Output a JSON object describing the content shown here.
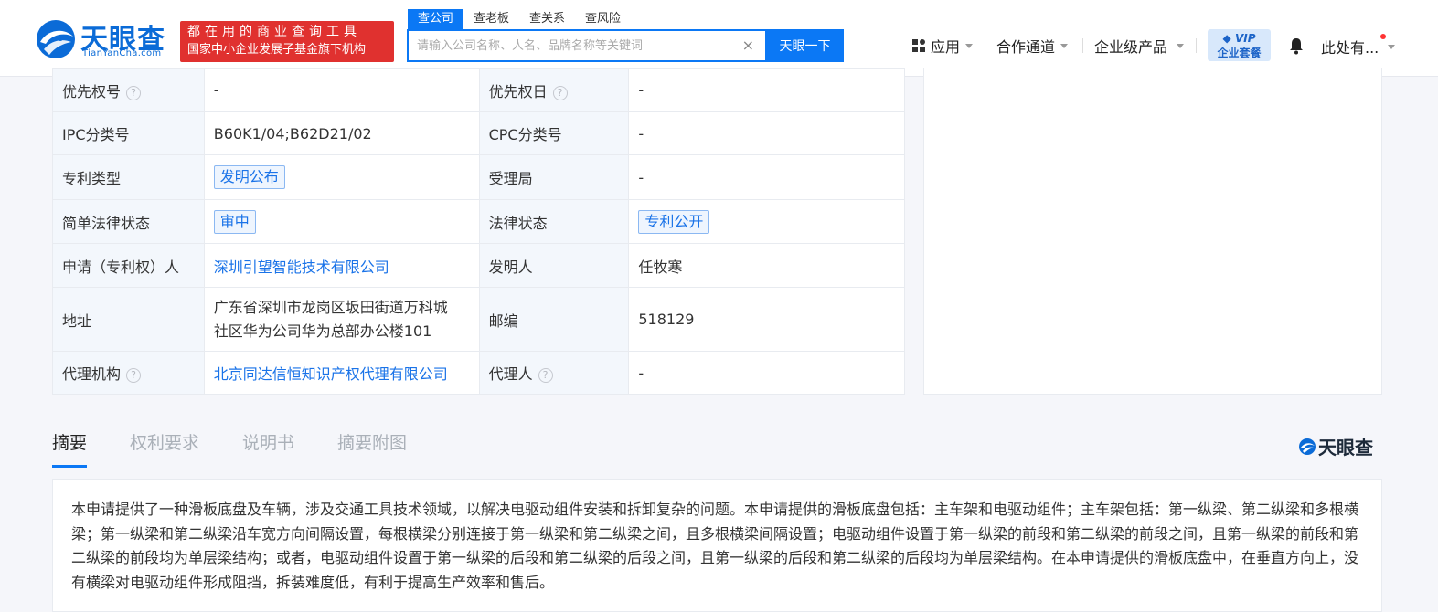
{
  "header": {
    "logo_text": "天眼查",
    "logo_sub": "TianYanCha.com",
    "slogan_line1": "都在用的商业查询工具",
    "slogan_line2": "国家中小企业发展子基金旗下机构",
    "search_tabs": [
      "查公司",
      "查老板",
      "查关系",
      "查风险"
    ],
    "search_placeholder": "请输入公司名称、人名、品牌名称等关键词",
    "search_button": "天眼一下",
    "nav": {
      "apps": "应用",
      "cooperation": "合作通道",
      "enterprise": "企业级产品",
      "vip_line1": "VIP",
      "vip_line2": "企业套餐",
      "user": "此处有..."
    }
  },
  "info_rows": [
    {
      "l1": "优先权号",
      "v1": "-",
      "l2": "优先权日",
      "v2": "-"
    },
    {
      "l1": "IPC分类号",
      "v1": "B60K1/04;B62D21/02",
      "l2": "CPC分类号",
      "v2": "-"
    },
    {
      "l1": "专利类型",
      "v1": "发明公布",
      "l2": "受理局",
      "v2": "-"
    },
    {
      "l1": "简单法律状态",
      "v1": "审中",
      "l2": "法律状态",
      "v2": "专利公开"
    },
    {
      "l1": "申请（专利权）人",
      "v1": "深圳引望智能技术有限公司",
      "l2": "发明人",
      "v2": "任牧寒"
    },
    {
      "l1": "地址",
      "v1a": "广东省深圳市龙岗区坂田街道万科城",
      "v1b": "社区华为公司华为总部办公楼101",
      "l2": "邮编",
      "v2": "518129"
    },
    {
      "l1": "代理机构",
      "v1": "北京同达信恒知识产权代理有限公司",
      "l2": "代理人",
      "v2": "-"
    }
  ],
  "content_tabs": [
    "摘要",
    "权利要求",
    "说明书",
    "摘要附图"
  ],
  "brand_small": "天眼查",
  "abstract": "本申请提供了一种滑板底盘及车辆，涉及交通工具技术领域，以解决电驱动组件安装和拆卸复杂的问题。本申请提供的滑板底盘包括：主车架和电驱动组件；主车架包括：第一纵梁、第二纵梁和多根横梁；第一纵梁和第二纵梁沿车宽方向间隔设置，每根横梁分别连接于第一纵梁和第二纵梁之间，且多根横梁间隔设置；电驱动组件设置于第一纵梁的前段和第二纵梁的前段之间，且第一纵梁的前段和第二纵梁的前段均为单层梁结构；或者，电驱动组件设置于第一纵梁的后段和第二纵梁的后段之间，且第一纵梁的后段和第二纵梁的后段均为单层梁结构。在本申请提供的滑板底盘中，在垂直方向上，没有横梁对电驱动组件形成阻挡，拆装难度低，有利于提高生产效率和售后。",
  "colors": {
    "accent": "#0b78f5",
    "slogan_bg": "#e0312f",
    "label_bg": "#f3f7fc"
  }
}
